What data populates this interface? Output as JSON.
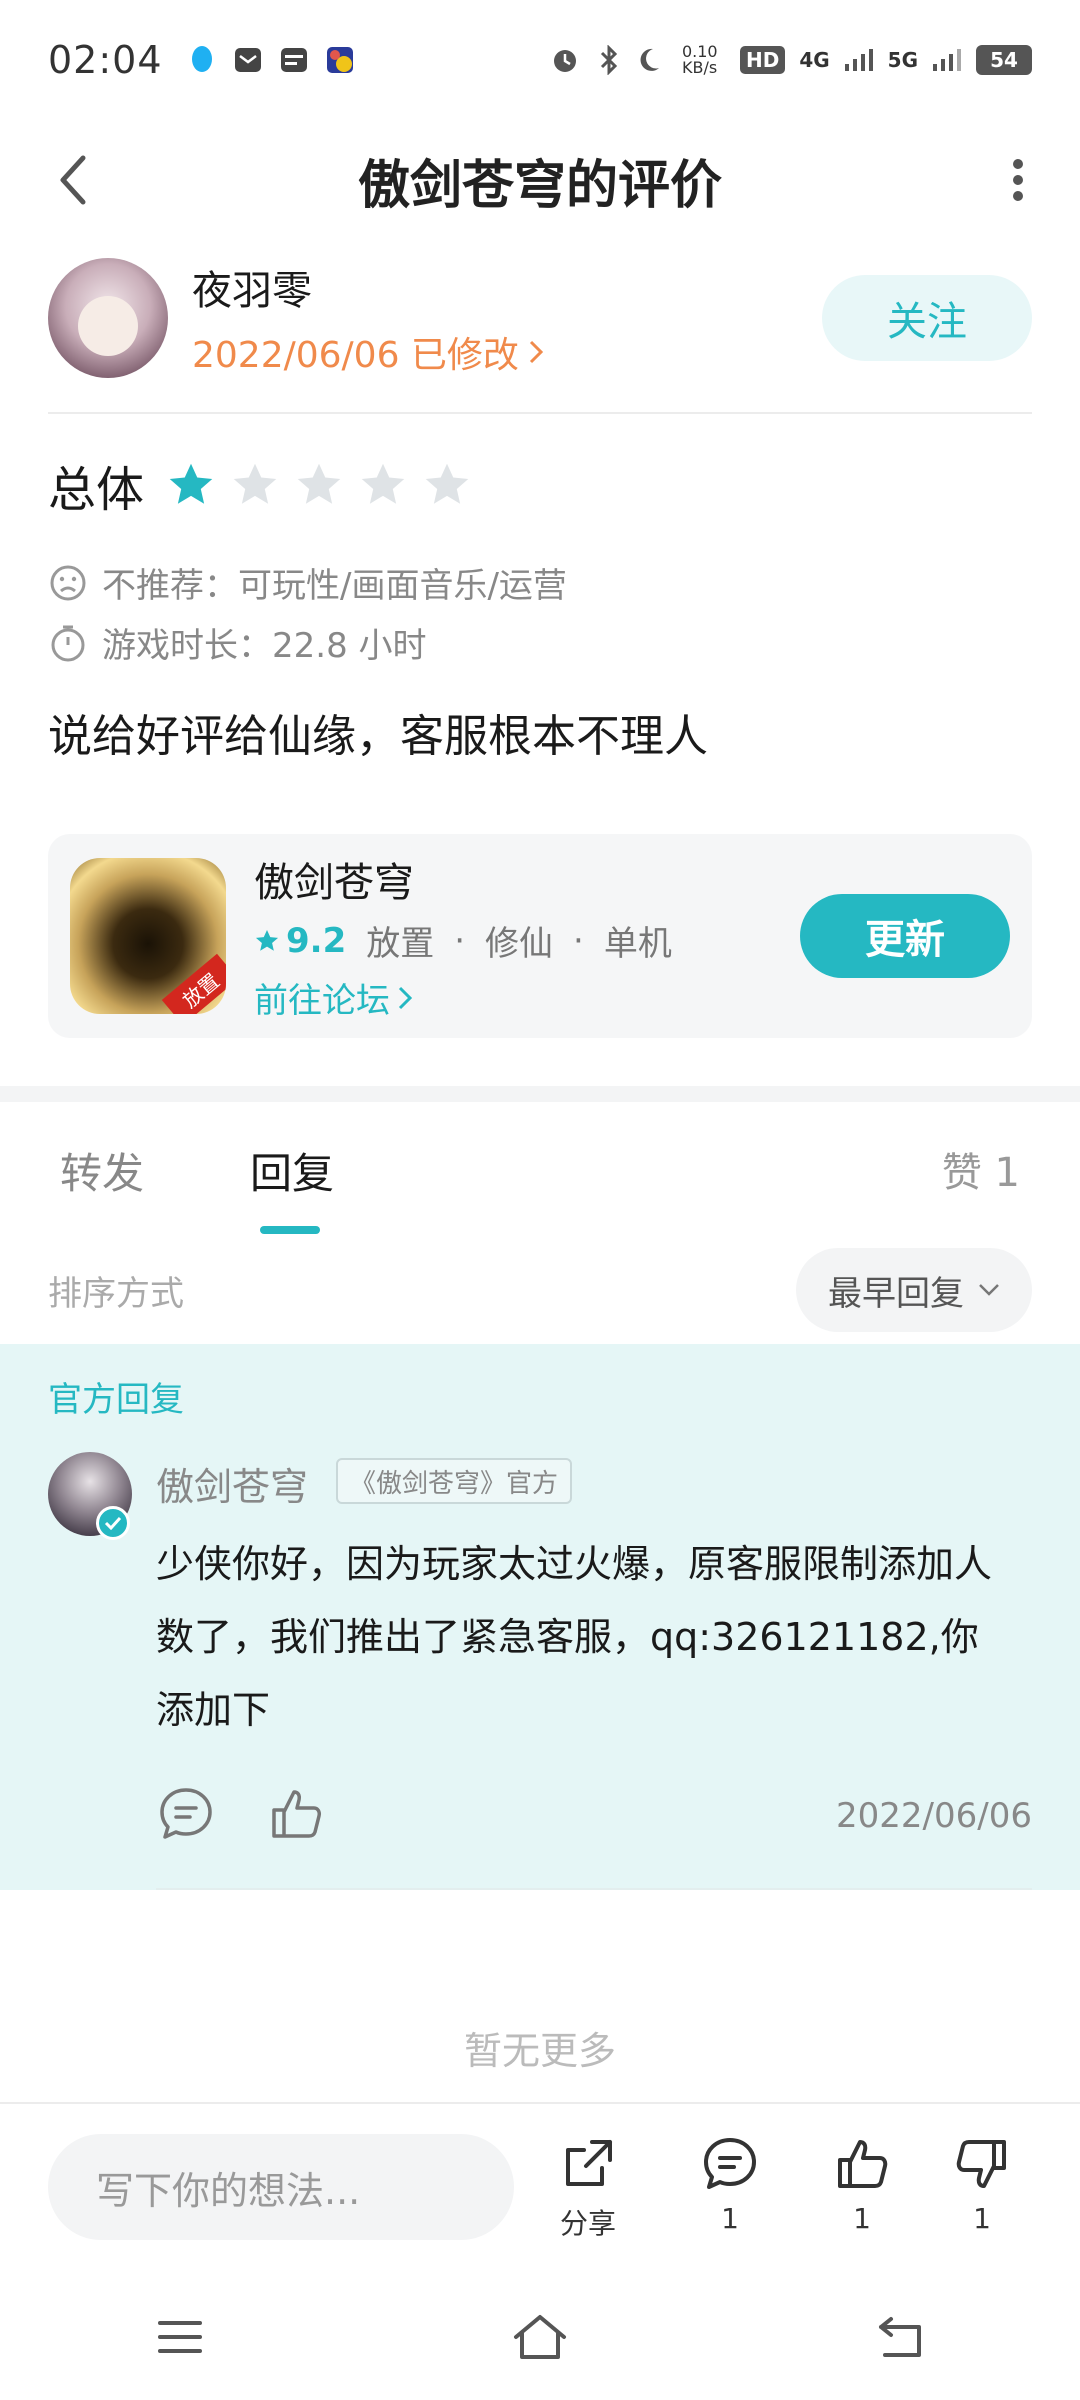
{
  "status_bar": {
    "time": "02:04",
    "net_speed": "0.10 KB/s",
    "hd_label": "HD",
    "network_4g": "4G",
    "network_5g": "5G",
    "battery": "54"
  },
  "header": {
    "title": "傲剑苍穹的评价"
  },
  "author": {
    "name": "夜羽零",
    "date": "2022/06/06 已修改",
    "follow_label": "关注"
  },
  "rating": {
    "label": "总体",
    "value": 1,
    "max": 5,
    "color_filled": "#25b8c2",
    "color_empty": "#dfe3e6"
  },
  "meta": {
    "not_recommend": "不推荐：可玩性/画面音乐/运营",
    "playtime": "游戏时长：22.8 小时"
  },
  "review": {
    "text": "说给好评给仙缘，客服根本不理人"
  },
  "game": {
    "name": "傲剑苍穹",
    "score": "9.2",
    "tag1": "放置",
    "tag2": "修仙",
    "tag3": "单机",
    "dot": "·",
    "forum_link": "前往论坛",
    "badge": "放置",
    "update_label": "更新"
  },
  "tabs": {
    "forward": "转发",
    "reply": "回复",
    "likes": "赞 1"
  },
  "sort": {
    "label": "排序方式",
    "selected": "最早回复"
  },
  "official_reply": {
    "section_label": "官方回复",
    "name": "傲剑苍穹",
    "tag": "《傲剑苍穹》官方",
    "text": "少侠你好，因为玩家太过火爆，原客服限制添加人数了，我们推出了紧急客服，qq:326121182,你添加下",
    "date": "2022/06/06"
  },
  "footer": {
    "no_more": "暂无更多"
  },
  "bottom_bar": {
    "input_placeholder": "写下你的想法...",
    "share_label": "分享",
    "comment_count": "1",
    "like_count": "1",
    "dislike_count": "1"
  },
  "colors": {
    "accent": "#25b8c2",
    "date_orange": "#f08a4b",
    "official_bg": "#e5f6f6"
  }
}
